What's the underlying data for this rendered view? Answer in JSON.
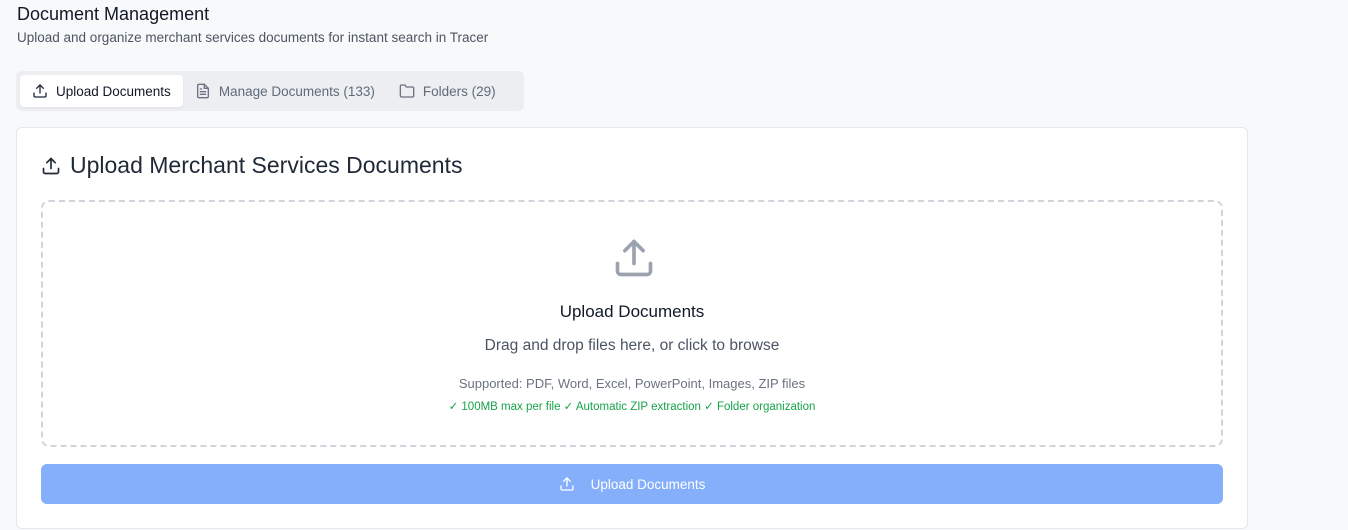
{
  "header": {
    "title": "Document Management",
    "subtitle": "Upload and organize merchant services documents for instant search in Tracer"
  },
  "tabs": [
    {
      "label": "Upload Documents",
      "icon": "upload-icon",
      "active": true
    },
    {
      "label": "Manage Documents (133)",
      "icon": "file-text-icon",
      "active": false
    },
    {
      "label": "Folders (29)",
      "icon": "folder-icon",
      "active": false
    }
  ],
  "card": {
    "title": "Upload Merchant Services Documents",
    "title_icon": "upload-icon"
  },
  "dropzone": {
    "icon": "upload-icon",
    "title": "Upload Documents",
    "description": "Drag and drop files here, or click to browse",
    "supported": "Supported: PDF, Word, Excel, PowerPoint, Images, ZIP files",
    "features": "✓ 100MB max per file ✓ Automatic ZIP extraction ✓ Folder organization"
  },
  "upload_button": {
    "label": "Upload Documents",
    "icon": "upload-icon"
  },
  "colors": {
    "background": "#f8f9fa",
    "button_disabled": "#85aefb",
    "success_text": "#16a34a",
    "tab_bar": "#eceef1"
  }
}
